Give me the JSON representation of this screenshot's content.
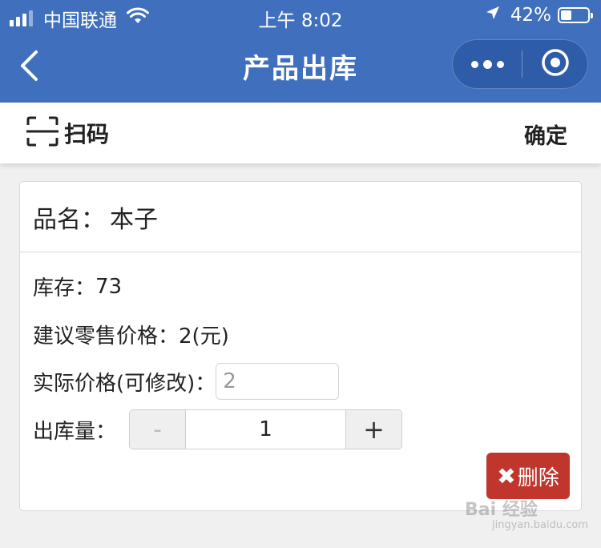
{
  "status_bar": {
    "carrier": "中国联通",
    "time": "上午 8:02",
    "battery": "42%",
    "battery_level": 0.42,
    "icons": [
      "signal-icon",
      "wifi-icon",
      "location-arrow-icon",
      "battery-icon"
    ]
  },
  "nav": {
    "title": "产品出库",
    "icons": [
      "back-chevron-icon",
      "more-dots-icon",
      "close-target-icon"
    ]
  },
  "toolbar": {
    "scan_label": "扫码",
    "confirm_label": "确定",
    "icons": [
      "scan-frame-icon"
    ]
  },
  "product": {
    "name_label": "品名：",
    "name": "本子",
    "stock_label": "库存：",
    "stock": "73",
    "suggested_price_label": "建议零售价格：",
    "suggested_price": "2(元)",
    "actual_price_label": "实际价格(可修改)：",
    "actual_price": "2",
    "quantity_label": "出库量：",
    "quantity": "1",
    "minus_label": "-",
    "plus_label": "+"
  },
  "actions": {
    "delete_label": "删除",
    "delete_icon": "✖",
    "delete_color": "#c0362c"
  },
  "colors": {
    "header": "#4070bd",
    "background": "#f0f0f0"
  },
  "watermark": {
    "text": "Bai 经验",
    "sub": "jingyan.baidu.com"
  }
}
